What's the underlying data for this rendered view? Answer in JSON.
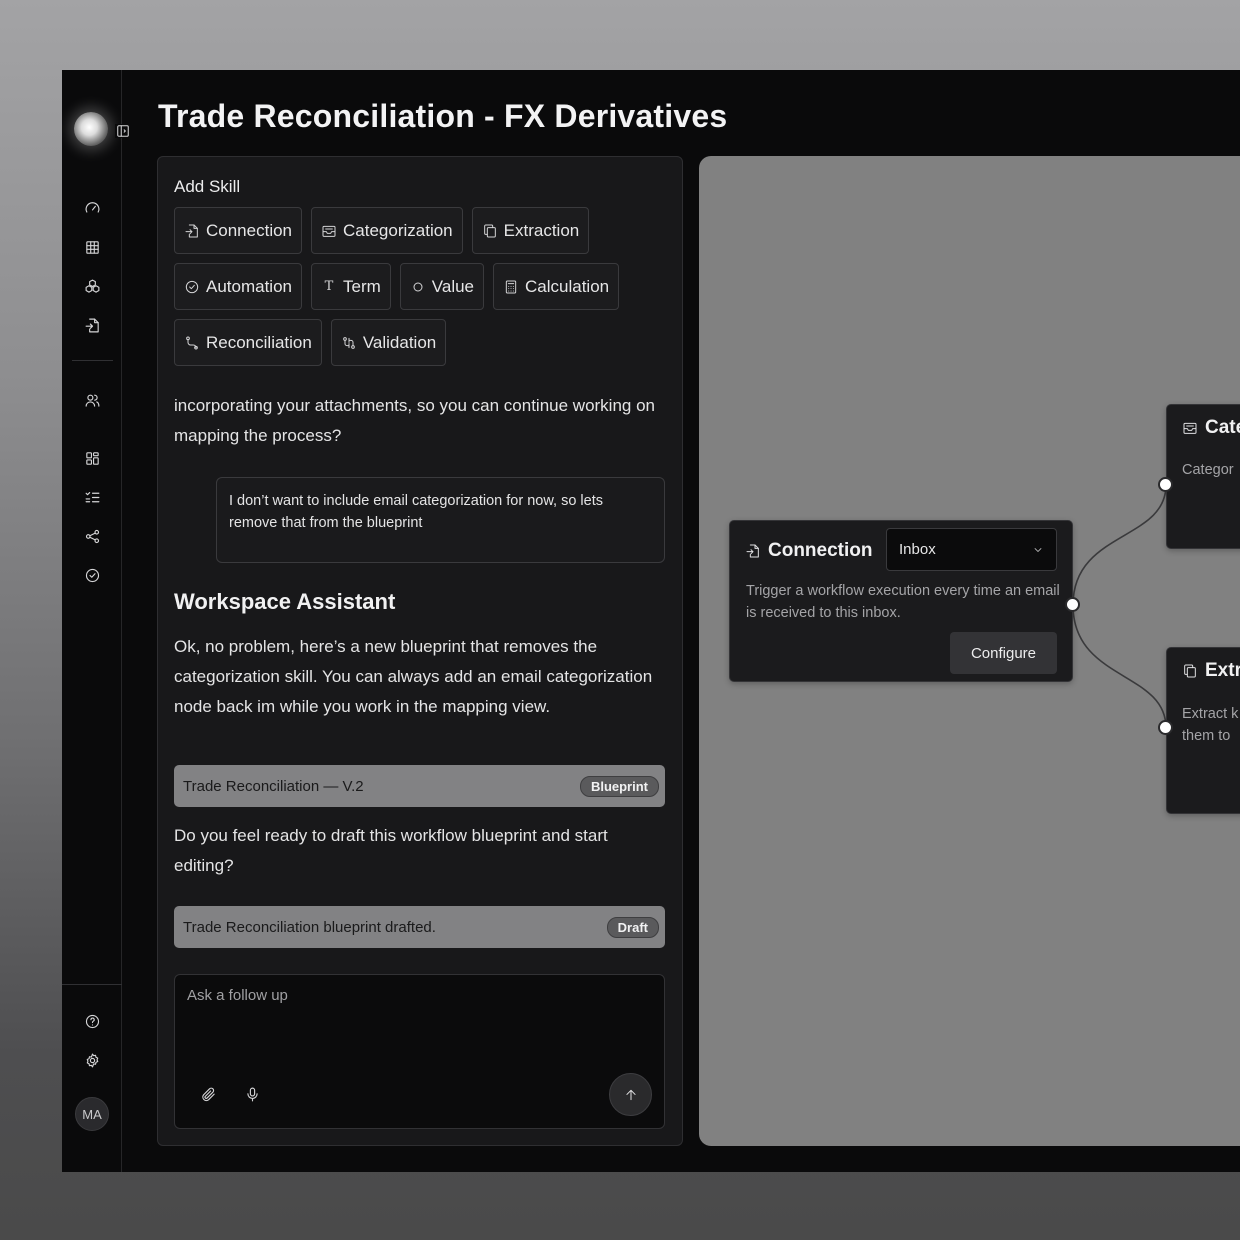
{
  "page_title": "Trade Reconciliation - FX Derivatives",
  "sidebar": {
    "top_icons": [
      "speedometer-icon",
      "table-icon",
      "cubes-icon",
      "file-import-icon"
    ],
    "mid_icons": [
      "users-icon",
      "dashboard-icon",
      "checklist-icon",
      "share-nodes-icon",
      "check-circle-icon"
    ],
    "bottom_icons": [
      "help-icon",
      "settings-icon"
    ],
    "avatar_initials": "MA"
  },
  "chat": {
    "add_skill_label": "Add Skill",
    "skills": [
      {
        "label": "Connection",
        "icon": "file-import-icon"
      },
      {
        "label": "Categorization",
        "icon": "inbox-icon"
      },
      {
        "label": "Extraction",
        "icon": "copy-icon"
      },
      {
        "label": "Automation",
        "icon": "check-circle-icon"
      },
      {
        "label": "Term",
        "icon": "text-t-icon"
      },
      {
        "label": "Value",
        "icon": "circle-icon"
      },
      {
        "label": "Calculation",
        "icon": "calculator-icon"
      },
      {
        "label": "Reconciliation",
        "icon": "route-icon"
      },
      {
        "label": "Validation",
        "icon": "git-compare-icon"
      }
    ],
    "assistant_intro_text": "incorporating your attachments, so you can continue working on mapping the process?",
    "user_message": "I don’t want to include email categorization for now, so lets remove that from the blueprint",
    "assistant_name": "Workspace Assistant",
    "assistant_reply": "Ok, no problem, here’s a new blueprint that removes the categorization skill. You can always add an email categorization node back im while you work in the mapping view.",
    "blueprint_artifact": {
      "title": "Trade Reconciliation — V.2",
      "badge": "Blueprint"
    },
    "assistant_question": "Do you feel ready to draft this workflow blueprint and start editing?",
    "draft_artifact": {
      "title": "Trade Reconciliation blueprint drafted.",
      "badge": "Draft"
    },
    "composer": {
      "placeholder": "Ask a follow up"
    }
  },
  "canvas": {
    "connection_node": {
      "title": "Connection",
      "select_value": "Inbox",
      "description": "Trigger a workflow execution every time an email is received to this inbox.",
      "configure_label": "Configure"
    },
    "categorization_node": {
      "title": "Cate",
      "description": "Categor"
    },
    "extraction_node": {
      "title": "Extr",
      "description_line1": "Extract k",
      "description_line2": "them to"
    }
  },
  "colors": {
    "app_background": "#0a0a0b",
    "panel_background": "#18181a",
    "canvas_background": "#818181",
    "artifact_background": "#828284"
  }
}
